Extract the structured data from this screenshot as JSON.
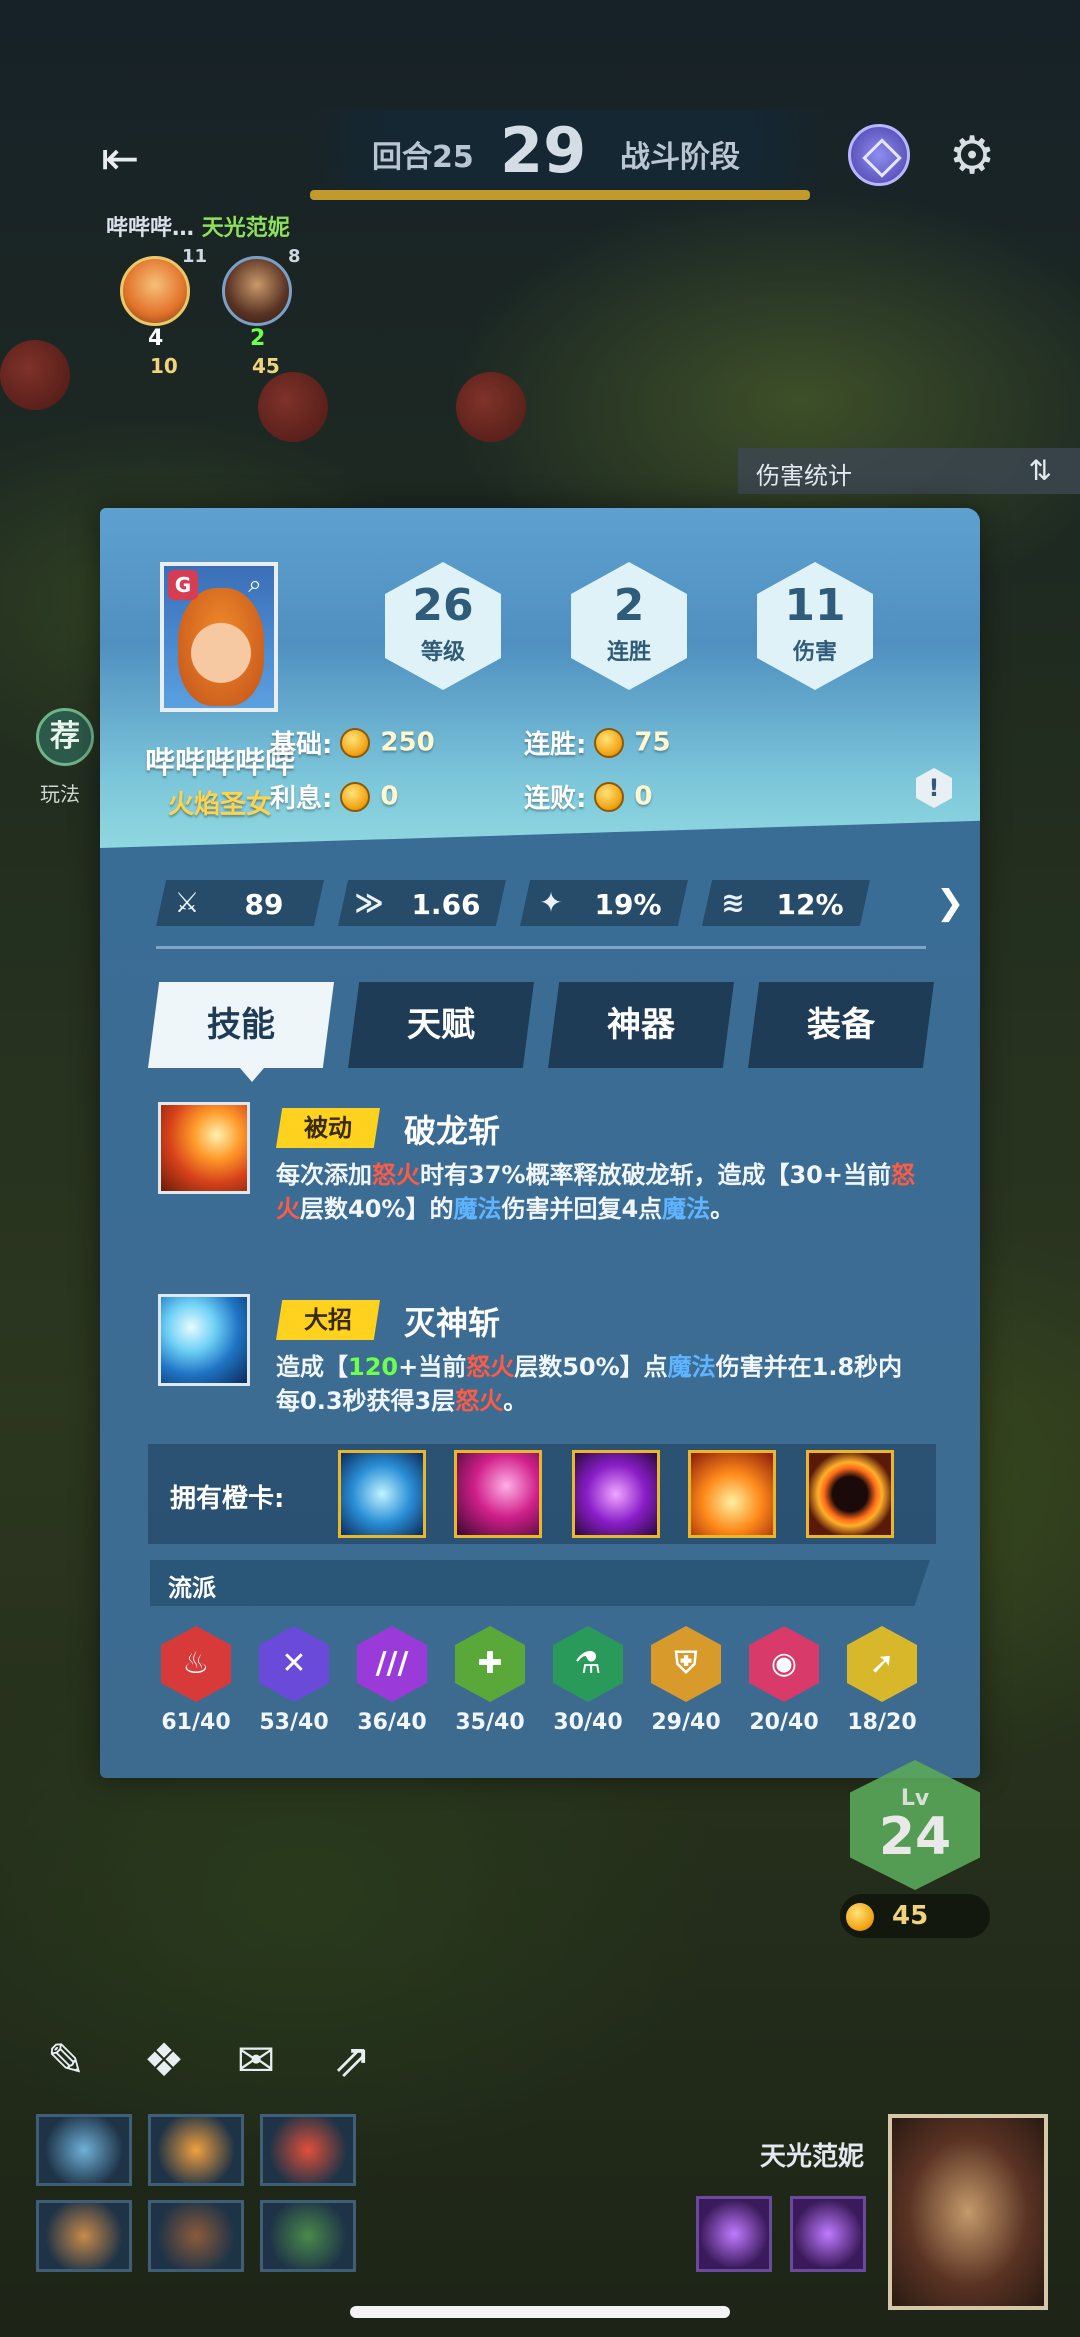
{
  "top": {
    "round_label": "回合25",
    "round_number": "29",
    "phase_label": "战斗阶段",
    "player_short": "哔哔哔…",
    "partner_name": "天光范妮",
    "mini_a_level": "11",
    "mini_a_hp": "4",
    "mini_a_gold": "10",
    "mini_b_level": "8",
    "mini_b_hp": "2",
    "mini_b_gold": "45"
  },
  "side": {
    "recommend_icon": "荐",
    "recommend_label": "玩法"
  },
  "damage_panel": {
    "title": "伤害统计",
    "sort_icon": "⇅"
  },
  "profile": {
    "name": "哔哔哔哔哔",
    "title": "火焰圣女",
    "hexes": [
      {
        "value": "26",
        "label": "等级"
      },
      {
        "value": "2",
        "label": "连胜"
      },
      {
        "value": "11",
        "label": "伤害"
      }
    ],
    "economy": {
      "base_label": "基础:",
      "base_value": "250",
      "streak_label": "连胜:",
      "streak_value": "75",
      "interest_label": "利息:",
      "interest_value": "0",
      "lose_label": "连败:",
      "lose_value": "0"
    },
    "info_icon": "!"
  },
  "stats": [
    {
      "icon": "sword-icon",
      "glyph": "⚔",
      "value": "89"
    },
    {
      "icon": "attack-speed-icon",
      "glyph": "≫",
      "value": "1.66"
    },
    {
      "icon": "crit-icon",
      "glyph": "✦",
      "value": "19%"
    },
    {
      "icon": "dodge-icon",
      "glyph": "≋",
      "value": "12%"
    }
  ],
  "tabs": [
    "技能",
    "天赋",
    "神器",
    "装备"
  ],
  "skills": [
    {
      "tag": "被动",
      "name": "破龙斩",
      "desc_parts": [
        "每次添加",
        "怒火",
        "时有37%概率释放破龙斩，造成【30+当前",
        "怒火",
        "层数40%】的",
        "魔法",
        "伤害并回复4点",
        "魔法",
        "。"
      ]
    },
    {
      "tag": "大招",
      "name": "灭神斩",
      "desc_parts": [
        "造成【",
        "120",
        "+当前",
        "怒火",
        "层数50%】点",
        "魔法",
        "伤害并在1.8秒内每0.3秒获得3层",
        "怒火",
        "。"
      ]
    }
  ],
  "orange_cards_label": "拥有橙卡:",
  "school_label": "流派",
  "traits": [
    {
      "icon": "flame-trait-icon",
      "glyph": "♨",
      "color": "#d83a3a",
      "count": "61/40"
    },
    {
      "icon": "hammer-trait-icon",
      "glyph": "✕",
      "color": "#6a4ad8",
      "count": "53/40"
    },
    {
      "icon": "claw-trait-icon",
      "glyph": "///",
      "color": "#9a3ad8",
      "count": "36/40"
    },
    {
      "icon": "heal-trait-icon",
      "glyph": "✚",
      "color": "#5aa83a",
      "count": "35/40"
    },
    {
      "icon": "potion-trait-icon",
      "glyph": "⚗",
      "color": "#2a9a5a",
      "count": "30/40"
    },
    {
      "icon": "shield-trait-icon",
      "glyph": "⛨",
      "color": "#d89a2a",
      "count": "29/40"
    },
    {
      "icon": "eye-trait-icon",
      "glyph": "◉",
      "color": "#d83a6a",
      "count": "20/40"
    },
    {
      "icon": "arm-trait-icon",
      "glyph": "➚",
      "color": "#d8b82a",
      "count": "18/20"
    }
  ],
  "lower": {
    "lv_label": "Lv",
    "lv_value": "24",
    "gold_value": "45",
    "opponent_name": "天光范妮"
  }
}
